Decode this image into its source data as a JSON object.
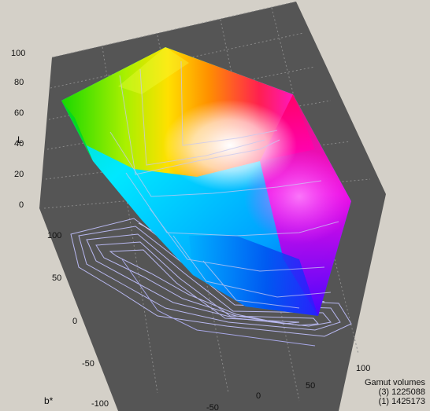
{
  "chart_data": {
    "type": "3d-gamut",
    "axes": {
      "L": {
        "label": "L",
        "ticks": [
          "0",
          "20",
          "40",
          "60",
          "80",
          "100"
        ],
        "range": [
          0,
          100
        ]
      },
      "b": {
        "label": "b*",
        "ticks": [
          "-100",
          "-50",
          "0",
          "50",
          "100"
        ],
        "range": [
          -100,
          100
        ]
      },
      "a": {
        "label": "",
        "ticks": [
          "-50",
          "0",
          "50",
          "100"
        ],
        "range": [
          -100,
          100
        ]
      }
    },
    "grid": true,
    "legend": {
      "title": "Gamut volumes",
      "placement": "bottom-right",
      "entries": [
        {
          "label": "(3)",
          "value": "1225088"
        },
        {
          "label": "(1)",
          "value": "1425173"
        }
      ]
    },
    "colors": {
      "background": "#d4d0c8",
      "box": "#555555",
      "grid": "#808080",
      "wireframe": "#b8b8f0"
    }
  }
}
